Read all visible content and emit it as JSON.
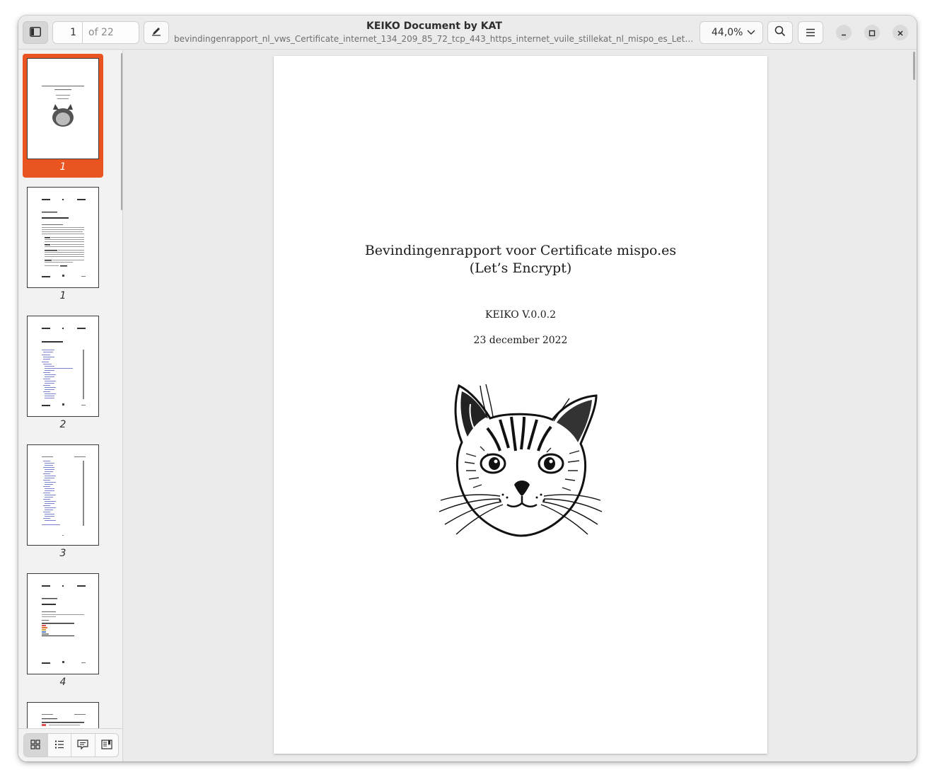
{
  "header": {
    "title": "KEIKO Document by KAT",
    "subtitle": "bevindingenrapport_nl_vws_Certificate_internet_134_209_85_72_tcp_443_https_internet_vuile_stillekat_nl_mispo_es_Let_s_...",
    "page_number": "1",
    "page_count_label": "of 22",
    "zoom_label": "44,0%"
  },
  "icons": {
    "sidebar_toggle": "sidebar-icon",
    "annotate": "pencil-icon",
    "zoom_dropdown": "chevron-down-icon",
    "search": "search-icon",
    "menu": "hamburger-menu-icon",
    "minimize": "minimize-icon",
    "maximize": "maximize-icon",
    "close": "close-icon"
  },
  "thumbnails": [
    {
      "label": "1",
      "selected": true
    },
    {
      "label": "1",
      "selected": false
    },
    {
      "label": "2",
      "selected": false
    },
    {
      "label": "3",
      "selected": false
    },
    {
      "label": "4",
      "selected": false
    }
  ],
  "document": {
    "title": "Bevindingenrapport voor Certificate mispo.es (Let’s Encrypt)",
    "version": "KEIKO V.0.0.2",
    "date": "23 december 2022"
  },
  "colors": {
    "accent": "#e95420",
    "window_bg": "#ebebeb",
    "sidebar_bg": "#f2f2f2"
  }
}
